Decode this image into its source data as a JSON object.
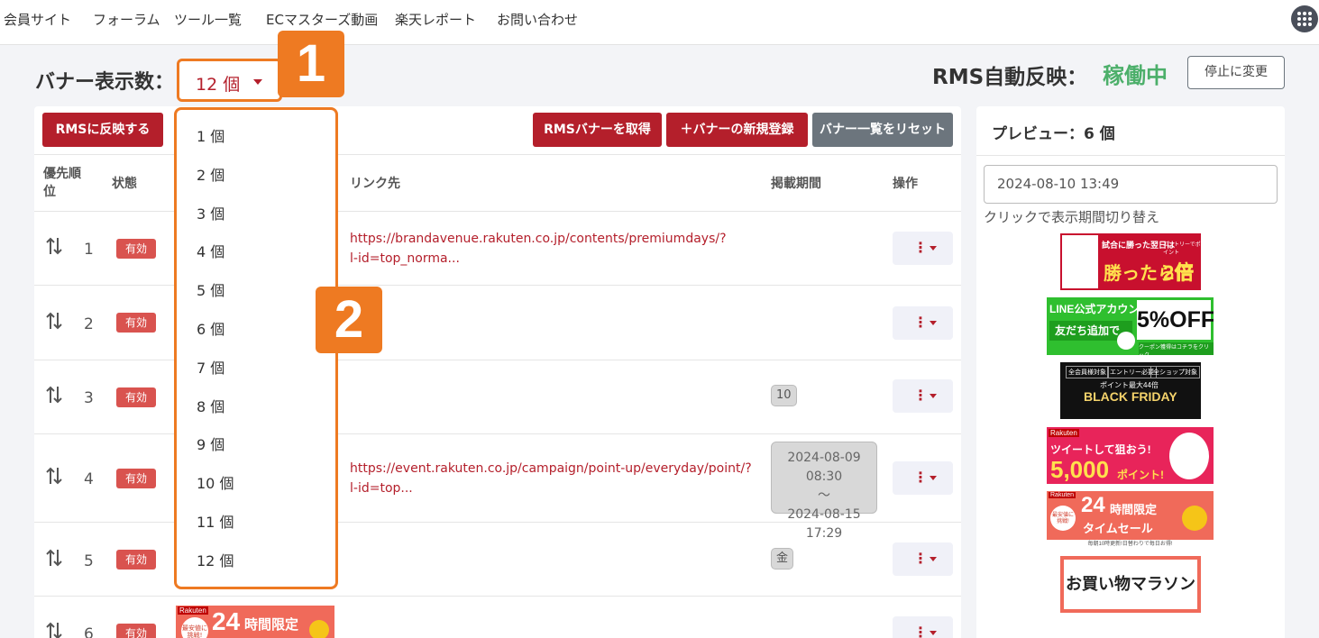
{
  "nav": {
    "items": [
      "会員サイト",
      "フォーラム",
      "ツール一覧",
      "ECマスターズ動画",
      "楽天レポート",
      "お問い合わせ"
    ],
    "apps_icon": "grid-apps-icon"
  },
  "header": {
    "title": "バナー表示数：",
    "selected_count": "12 個",
    "step1": "1",
    "step2": "2",
    "rms_label": "RMS自動反映：",
    "rms_value": "稼働中",
    "stop_button": "停止に変更"
  },
  "toolbar": {
    "reflect_button": "RMSに反映する",
    "fetch_button": "RMSバナーを取得",
    "new_button": "＋バナーの新規登録",
    "reset_button": "バナー一覧をリセット"
  },
  "table": {
    "headers": {
      "priority": "優先順\n位",
      "status": "状態",
      "link": "リンク先",
      "period": "掲載期間",
      "ops": "操作"
    },
    "rows": [
      {
        "rank": "1",
        "status": "有効",
        "link": "https://brandavenue.rakuten.co.jp/contents/premiumdays/?l-id=top_norma..."
      },
      {
        "rank": "2",
        "status": "有効",
        "link": ""
      },
      {
        "rank": "3",
        "status": "有効",
        "link": "",
        "period": "10"
      },
      {
        "rank": "4",
        "status": "有効",
        "link": "https://event.rakuten.co.jp/campaign/point-up/everyday/point/?l-id=top...",
        "period_start": "2024-08-09 08:30",
        "period_sep": "～",
        "period_end": "2024-08-15 17:29"
      },
      {
        "rank": "5",
        "status": "有効",
        "link": "",
        "period": "金"
      },
      {
        "rank": "6",
        "status": "有効",
        "link": ""
      }
    ],
    "row6_thumb": {
      "brand": "Rakuten",
      "big": "24",
      "text": "時間限定",
      "sub": "最安値に挑戦!"
    }
  },
  "dropdown": {
    "options": [
      "1 個",
      "2 個",
      "3 個",
      "4 個",
      "5 個",
      "6 個",
      "7 個",
      "8 個",
      "9 個",
      "10 個",
      "11 個",
      "12 個"
    ]
  },
  "preview": {
    "title": "プレビュー：6 個",
    "date_value": "2024-08-10 13:49",
    "hint": "クリックで表示期間切り替え",
    "banners": [
      {
        "text1": "試合に勝った翌日は",
        "text2": "エントリーでポイント",
        "text3": "勝ったら倍",
        "text4": "2倍"
      },
      {
        "text1": "LINE公式アカウント",
        "text2": "友だち追加で",
        "text3": "5%OFF",
        "text4": "クーポン獲得はコチラをクリック"
      },
      {
        "text1": "全会員様対象",
        "text2": "エントリー必要",
        "text3": "全ショップ対象",
        "text4": "ポイント最大44倍",
        "text5": "BLACK FRIDAY"
      },
      {
        "text1": "Rakuten",
        "text2": "ツイートして狙おう!",
        "text3": "5,000",
        "text4": "ポイント!"
      },
      {
        "text1": "Rakuten",
        "text2": "最安値に挑戦!",
        "text3": "24",
        "text4": "時間限定",
        "text5": "タイムセール",
        "text6": "毎朝10時更新!日替わりで毎日お得!"
      },
      {
        "text1": "お買い物マラソン"
      }
    ]
  },
  "colors": {
    "accent": "#b41f2b",
    "orange": "#ee7a22",
    "green": "#4caf6a",
    "gray": "#6c757d"
  }
}
